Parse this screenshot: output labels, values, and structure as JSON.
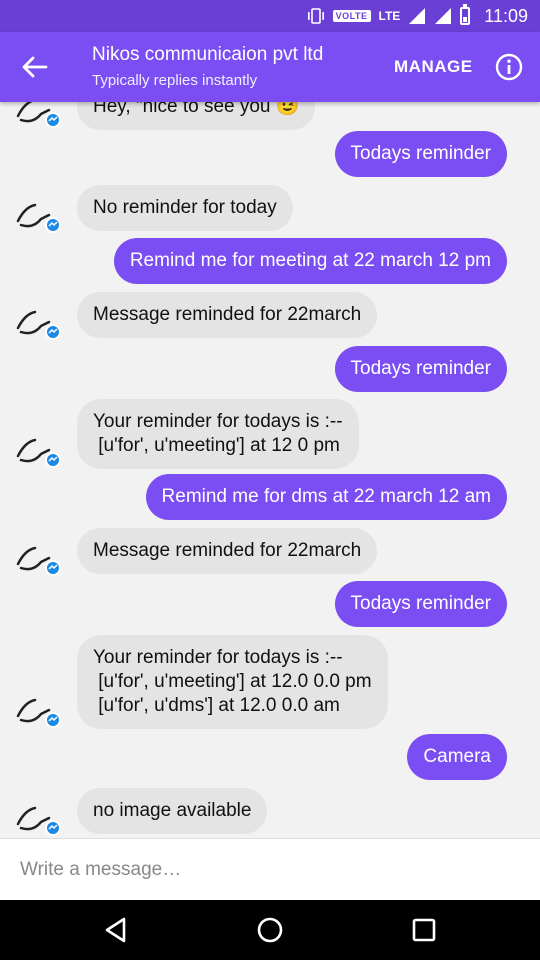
{
  "status_bar": {
    "volte": "VOLTE",
    "network": "LTE",
    "time": "11:09",
    "icons": [
      "vibrate-icon",
      "signal-icon",
      "signal-icon",
      "battery-icon"
    ]
  },
  "header": {
    "back_icon": "arrow-left-icon",
    "title": "Nikos communicaion pvt ltd",
    "subtitle": "Typically replies instantly",
    "manage_label": "MANAGE",
    "info_icon": "info-icon"
  },
  "messages": [
    {
      "from": "bot",
      "text": "Hey, \"nice to see you 😉"
    },
    {
      "from": "user",
      "text": "Todays reminder"
    },
    {
      "from": "bot",
      "text": "No reminder for today"
    },
    {
      "from": "user",
      "text": "Remind me for meeting at 22 march 12 pm"
    },
    {
      "from": "bot",
      "text": "Message reminded for 22march"
    },
    {
      "from": "user",
      "text": "Todays reminder"
    },
    {
      "from": "bot",
      "text": "Your reminder for todays is :--\n [u'for', u'meeting'] at 12 0 pm"
    },
    {
      "from": "user",
      "text": "Remind me for dms at 22 march 12 am"
    },
    {
      "from": "bot",
      "text": "Message reminded for 22march"
    },
    {
      "from": "user",
      "text": "Todays reminder"
    },
    {
      "from": "bot",
      "text": "Your reminder for todays is :--\n [u'for', u'meeting'] at 12.0 0.0 pm\n [u'for', u'dms'] at 12.0 0.0 am"
    },
    {
      "from": "user",
      "text": "Camera"
    },
    {
      "from": "bot",
      "text": "no image available"
    }
  ],
  "composer": {
    "placeholder": "Write a message…"
  },
  "nav_bar": {
    "icons": [
      "back-triangle-icon",
      "home-circle-icon",
      "recents-square-icon"
    ]
  },
  "colors": {
    "status_bar": "#6a3fd6",
    "app_bar": "#7a4ef2",
    "outgoing_bubble": "#7a4ef2",
    "incoming_bubble": "#e4e4e4",
    "messenger_badge": "#1e88e5"
  }
}
